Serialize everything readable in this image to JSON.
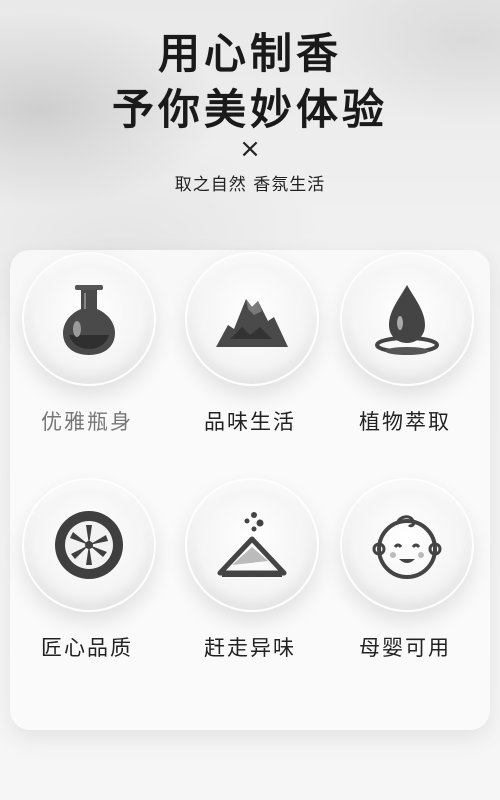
{
  "heading": {
    "line1": "用心制香",
    "line2": "予你美妙体验",
    "times": "×",
    "subtitle": "取之自然 香氛生活"
  },
  "features": [
    {
      "label": "优雅瓶身",
      "icon": "flask-icon"
    },
    {
      "label": "品味生活",
      "icon": "mountain-icon"
    },
    {
      "label": "植物萃取",
      "icon": "water-drop-icon"
    },
    {
      "label": "匠心品质",
      "icon": "citrus-slice-icon"
    },
    {
      "label": "赶走异味",
      "icon": "powder-pile-icon"
    },
    {
      "label": "母婴可用",
      "icon": "baby-face-icon"
    }
  ]
}
